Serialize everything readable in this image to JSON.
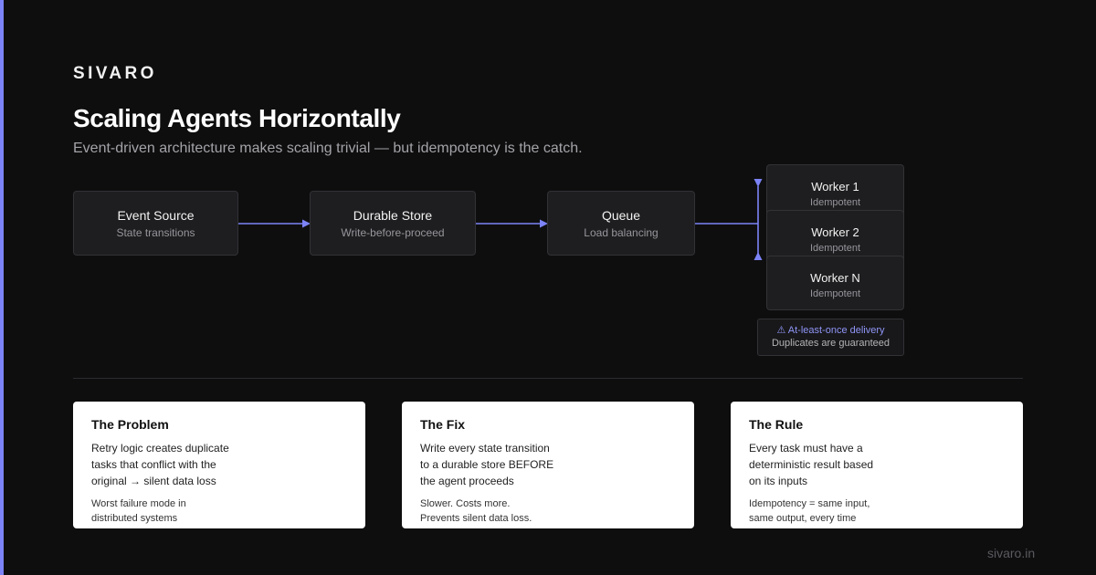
{
  "brand": "SIVARO",
  "title": "Scaling Agents Horizontally",
  "subtitle": "Event-driven architecture makes scaling trivial — but idempotency is the catch.",
  "flow": [
    {
      "title": "Event Source",
      "sub": "State transitions"
    },
    {
      "title": "Durable Store",
      "sub": "Write-before-proceed"
    },
    {
      "title": "Queue",
      "sub": "Load balancing"
    }
  ],
  "workers": [
    {
      "title": "Worker 1",
      "sub": "Idempotent"
    },
    {
      "title": "Worker 2",
      "sub": "Idempotent"
    },
    {
      "title": "Worker N",
      "sub": "Idempotent"
    }
  ],
  "warning": {
    "title": "⚠ At-least-once delivery",
    "sub": "Duplicates are guaranteed"
  },
  "cards": [
    {
      "title": "The Problem",
      "lines": [
        "Retry logic creates duplicate",
        "tasks that conflict with the",
        "original → silent data loss"
      ],
      "note": [
        "Worst failure mode in",
        "distributed systems"
      ]
    },
    {
      "title": "The Fix",
      "lines": [
        "Write every state transition",
        "to a durable store BEFORE",
        "the agent proceeds"
      ],
      "note": [
        "Slower. Costs more.",
        "Prevents silent data loss."
      ]
    },
    {
      "title": "The Rule",
      "lines": [
        "Every task must have a",
        "deterministic result based",
        "on its inputs"
      ],
      "note": [
        "Idempotency = same input,",
        "same output, every time"
      ]
    }
  ],
  "footer": "sivaro.in",
  "colors": {
    "accent": "#7c83f6",
    "background": "#0e0e0f",
    "node": "#1e1e20",
    "card": "#ffffff"
  }
}
